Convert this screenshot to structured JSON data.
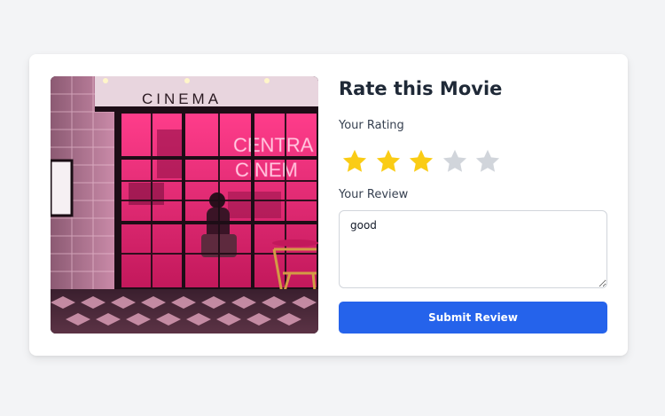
{
  "card": {
    "image": {
      "alt": "cinema-storefront-photo",
      "sign_text": "CINEMA",
      "neon_line1": "CENTRA",
      "neon_line2": "CINEM"
    },
    "title": "Rate this Movie",
    "rating_label": "Your Rating",
    "rating": {
      "value": 3,
      "max": 5
    },
    "review_label": "Your Review",
    "review_value": "good",
    "submit_label": "Submit Review"
  },
  "colors": {
    "star_filled": "#facc15",
    "star_empty": "#d1d5db",
    "button": "#2563eb"
  }
}
